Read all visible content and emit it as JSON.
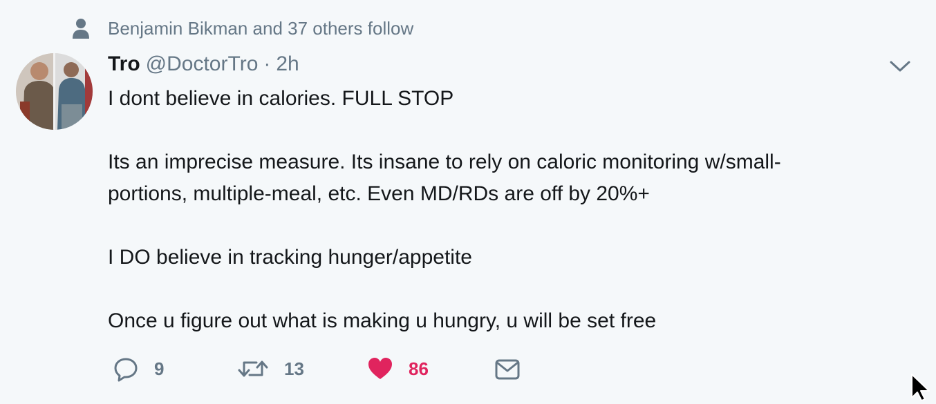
{
  "social_context": {
    "text": "Benjamin Bikman and 37 others follow",
    "icon": "person-icon"
  },
  "tweet": {
    "author": {
      "name": "Tro",
      "handle": "@DoctorTro",
      "separator": "·",
      "time": "2h"
    },
    "text_paragraphs": [
      "I dont believe in calories. FULL STOP",
      "Its an imprecise measure. Its insane to rely on caloric monitoring w/small-\nportions, multiple-meal, etc. Even MD/RDs are off by 20%+",
      "I DO believe in tracking hunger/appetite",
      "Once u figure out what is making u hungry, u will be set free"
    ],
    "actions": {
      "reply_count": "9",
      "retweet_count": "13",
      "like_count": "86"
    }
  },
  "colors": {
    "background": "#f5f8fa",
    "secondary_text": "#657786",
    "primary_text": "#14171a",
    "like": "#e0245e"
  },
  "icons": {
    "reply": "speech-bubble-icon",
    "retweet": "retweet-arrows-icon",
    "like": "heart-icon",
    "dm": "envelope-icon",
    "caret": "chevron-down-icon"
  }
}
